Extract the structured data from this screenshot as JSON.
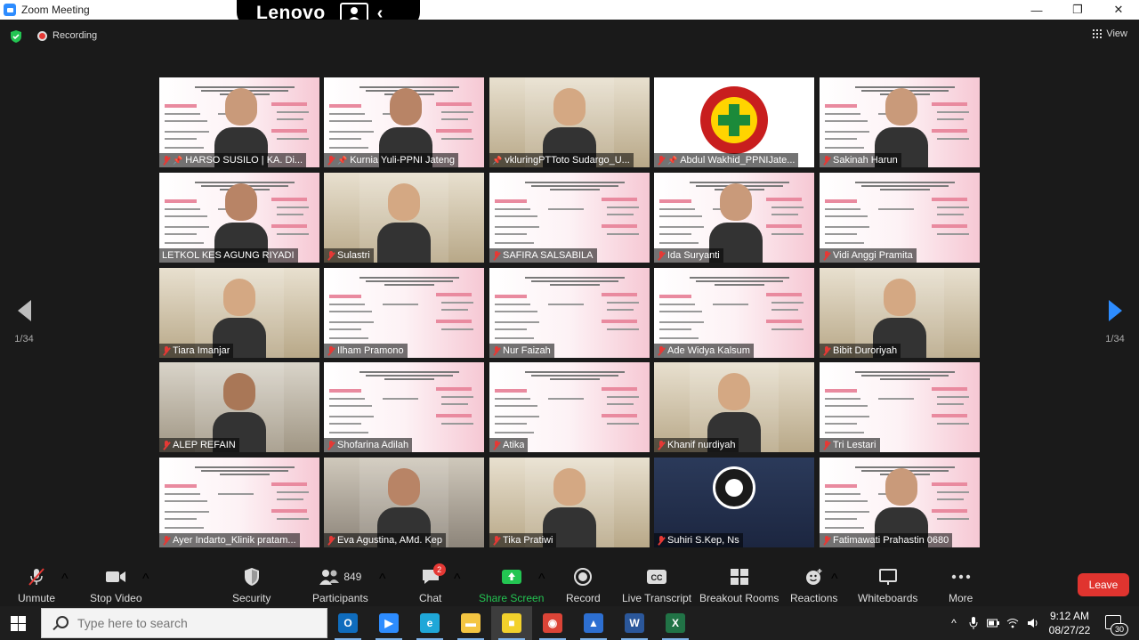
{
  "window": {
    "title": "Zoom Meeting",
    "controls": [
      "—",
      "❐",
      "✕"
    ]
  },
  "overlay": {
    "brand": "Lenovo"
  },
  "meeting": {
    "recording_label": "Recording",
    "view_label": "View",
    "page_indicator_left": "1/34",
    "page_indicator_right": "1/34"
  },
  "participants": [
    {
      "name": "HARSO SUSILO | KA. Di...",
      "muted": true,
      "pinned": true,
      "tile": "slide-cam",
      "active": false
    },
    {
      "name": "Kurnia Yuli-PPNI Jateng",
      "muted": true,
      "pinned": true,
      "tile": "slide-cam",
      "active": false
    },
    {
      "name": "vkluringPTToto Sudargo_U...",
      "muted": false,
      "pinned": true,
      "tile": "camera",
      "active": false
    },
    {
      "name": "Abdul Wakhid_PPNIJate...",
      "muted": true,
      "pinned": true,
      "tile": "logo",
      "active": false
    },
    {
      "name": "Sakinah Harun",
      "muted": true,
      "pinned": false,
      "tile": "slide-cam",
      "active": false
    },
    {
      "name": "LETKOL KES AGUNG RIYADI",
      "muted": false,
      "pinned": false,
      "tile": "slide-cam",
      "active": true
    },
    {
      "name": "Sulastri",
      "muted": true,
      "pinned": false,
      "tile": "camera",
      "active": false
    },
    {
      "name": "SAFIRA SALSABILA",
      "muted": true,
      "pinned": false,
      "tile": "slide",
      "active": false
    },
    {
      "name": "Ida Suryanti",
      "muted": true,
      "pinned": false,
      "tile": "slide-cam",
      "active": false
    },
    {
      "name": "Vidi Anggi Pramita",
      "muted": true,
      "pinned": false,
      "tile": "slide",
      "active": false
    },
    {
      "name": "Tiara Imanjar",
      "muted": true,
      "pinned": false,
      "tile": "camera",
      "active": false
    },
    {
      "name": "Ilham Pramono",
      "muted": true,
      "pinned": false,
      "tile": "slide",
      "active": false
    },
    {
      "name": "Nur Faizah",
      "muted": true,
      "pinned": false,
      "tile": "slide",
      "active": false
    },
    {
      "name": "Ade Widya Kalsum",
      "muted": true,
      "pinned": false,
      "tile": "slide",
      "active": false
    },
    {
      "name": "Bibit Duroriyah",
      "muted": true,
      "pinned": false,
      "tile": "camera",
      "active": false
    },
    {
      "name": "ALEP REFAIN",
      "muted": true,
      "pinned": false,
      "tile": "camera",
      "active": false
    },
    {
      "name": "Shofarina Adilah",
      "muted": true,
      "pinned": false,
      "tile": "slide",
      "active": false
    },
    {
      "name": "Atika",
      "muted": true,
      "pinned": false,
      "tile": "slide",
      "active": false
    },
    {
      "name": "Khanif nurdiyah",
      "muted": true,
      "pinned": false,
      "tile": "camera",
      "active": false
    },
    {
      "name": "Tri Lestari",
      "muted": true,
      "pinned": false,
      "tile": "slide",
      "active": false
    },
    {
      "name": "Ayer Indarto_Klinik pratam...",
      "muted": true,
      "pinned": false,
      "tile": "slide",
      "active": false
    },
    {
      "name": "Eva Agustina, AMd. Kep",
      "muted": true,
      "pinned": false,
      "tile": "camera",
      "active": false
    },
    {
      "name": "Tika Pratiwi",
      "muted": true,
      "pinned": false,
      "tile": "camera",
      "active": false
    },
    {
      "name": "Suhiri S.Kep, Ns",
      "muted": true,
      "pinned": false,
      "tile": "obs",
      "active": false
    },
    {
      "name": "Fatimawati Prahastin 0680",
      "muted": true,
      "pinned": false,
      "tile": "slide-cam",
      "active": false
    }
  ],
  "toolbar": {
    "unmute": "Unmute",
    "stop_video": "Stop Video",
    "security": "Security",
    "participants": "Participants",
    "participants_count": "849",
    "chat": "Chat",
    "chat_badge": "2",
    "share_screen": "Share Screen",
    "record": "Record",
    "live_transcript": "Live Transcript",
    "breakout_rooms": "Breakout Rooms",
    "reactions": "Reactions",
    "whiteboards": "Whiteboards",
    "more": "More",
    "leave": "Leave",
    "caret": "^",
    "cc_glyph": "CC"
  },
  "taskbar": {
    "search_placeholder": "Type here to search",
    "time": "9:12 AM",
    "date": "08/27/22",
    "notification_count": "30",
    "apps": [
      {
        "icon": "outlook-icon",
        "color": "#0f6cbd",
        "glyph": "O"
      },
      {
        "icon": "zoom-icon",
        "color": "#2d8cff",
        "glyph": "▶"
      },
      {
        "icon": "edge-icon",
        "color": "#1fa7d8",
        "glyph": "e"
      },
      {
        "icon": "file-explorer-icon",
        "color": "#f4c542",
        "glyph": "▬"
      },
      {
        "icon": "sticky-notes-icon",
        "color": "#f2d12c",
        "glyph": "■"
      },
      {
        "icon": "chrome-icon",
        "color": "#db4437",
        "glyph": "◉"
      },
      {
        "icon": "photos-icon",
        "color": "#2d6fd1",
        "glyph": "▲"
      },
      {
        "icon": "word-icon",
        "color": "#2b579a",
        "glyph": "W"
      },
      {
        "icon": "excel-icon",
        "color": "#217346",
        "glyph": "X"
      }
    ]
  }
}
